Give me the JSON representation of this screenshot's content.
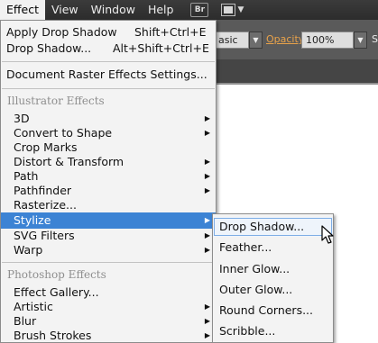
{
  "menubar": {
    "items": [
      "Effect",
      "View",
      "Window",
      "Help"
    ],
    "bridge_badge": "Br"
  },
  "controlbar": {
    "style_value": "asic",
    "opacity_label": "Opacity:",
    "opacity_value": "100%",
    "trailing_label": "S"
  },
  "effect_menu": {
    "apply_drop_shadow": {
      "label": "Apply Drop Shadow",
      "shortcut": "Shift+Ctrl+E"
    },
    "drop_shadow": {
      "label": "Drop Shadow...",
      "shortcut": "Alt+Shift+Ctrl+E"
    },
    "document_raster": "Document Raster Effects Settings...",
    "illustrator_header": "Illustrator Effects",
    "illustrator_items": [
      "3D",
      "Convert to Shape",
      "Crop Marks",
      "Distort & Transform",
      "Path",
      "Pathfinder",
      "Rasterize...",
      "Stylize",
      "SVG Filters",
      "Warp"
    ],
    "photoshop_header": "Photoshop Effects",
    "photoshop_items": [
      "Effect Gallery...",
      "Artistic",
      "Blur",
      "Brush Strokes"
    ]
  },
  "stylize_submenu": {
    "items": [
      "Drop Shadow...",
      "Feather...",
      "Inner Glow...",
      "Outer Glow...",
      "Round Corners...",
      "Scribble..."
    ]
  },
  "colors": {
    "selection": "#3c83d4",
    "opacity_link": "#e8a24a"
  }
}
